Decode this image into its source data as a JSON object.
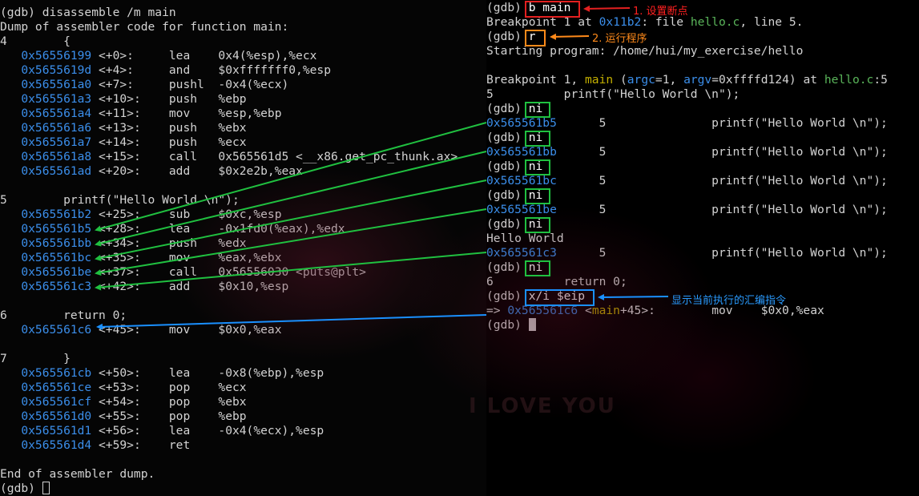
{
  "colors": {
    "address": "#3b8eea",
    "function_name": "#c4b000",
    "file_name": "#5ab55a",
    "annotation_red": "#e32020",
    "annotation_orange": "#ff8a1a",
    "annotation_green": "#20c040",
    "annotation_blue": "#1a90ff"
  },
  "left_terminal": {
    "command_line": "(gdb) disassemble /m main",
    "header": "Dump of assembler code for function main:",
    "src_4_num": "4",
    "src_4_code": "        {",
    "src_5_num": "5",
    "src_5_code": "        printf(\"Hello World \\n\");",
    "src_6_num": "6",
    "src_6_code": "        return 0;",
    "src_7_num": "7",
    "src_7_code": "        }",
    "block1": [
      {
        "addr": "0x56556199",
        "offset": " <+0>:     ",
        "mnemonic": "lea    ",
        "operands": "0x4(%esp),%ecx"
      },
      {
        "addr": "0x5655619d",
        "offset": " <+4>:     ",
        "mnemonic": "and    ",
        "operands": "$0xfffffff0,%esp"
      },
      {
        "addr": "0x565561a0",
        "offset": " <+7>:     ",
        "mnemonic": "pushl  ",
        "operands": "-0x4(%ecx)"
      },
      {
        "addr": "0x565561a3",
        "offset": " <+10>:    ",
        "mnemonic": "push   ",
        "operands": "%ebp"
      },
      {
        "addr": "0x565561a4",
        "offset": " <+11>:    ",
        "mnemonic": "mov    ",
        "operands": "%esp,%ebp"
      },
      {
        "addr": "0x565561a6",
        "offset": " <+13>:    ",
        "mnemonic": "push   ",
        "operands": "%ebx"
      },
      {
        "addr": "0x565561a7",
        "offset": " <+14>:    ",
        "mnemonic": "push   ",
        "operands": "%ecx"
      },
      {
        "addr": "0x565561a8",
        "offset": " <+15>:    ",
        "mnemonic": "call   ",
        "operands": "0x565561d5 <__x86.get_pc_thunk.ax>"
      },
      {
        "addr": "0x565561ad",
        "offset": " <+20>:    ",
        "mnemonic": "add    ",
        "operands": "$0x2e2b,%eax"
      }
    ],
    "block2": [
      {
        "addr": "0x565561b2",
        "offset": " <+25>:    ",
        "mnemonic": "sub    ",
        "operands": "$0xc,%esp"
      },
      {
        "addr": "0x565561b5",
        "offset": " <+28>:    ",
        "mnemonic": "lea    ",
        "operands": "-0x1fd0(%eax),%edx"
      },
      {
        "addr": "0x565561bb",
        "offset": " <+34>:    ",
        "mnemonic": "push   ",
        "operands": "%edx"
      },
      {
        "addr": "0x565561bc",
        "offset": " <+35>:    ",
        "mnemonic": "mov    ",
        "operands": "%eax,%ebx"
      },
      {
        "addr": "0x565561be",
        "offset": " <+37>:    ",
        "mnemonic": "call   ",
        "operands": "0x56556030 <puts@plt>"
      },
      {
        "addr": "0x565561c3",
        "offset": " <+42>:    ",
        "mnemonic": "add    ",
        "operands": "$0x10,%esp"
      }
    ],
    "block3": [
      {
        "addr": "0x565561c6",
        "offset": " <+45>:    ",
        "mnemonic": "mov    ",
        "operands": "$0x0,%eax"
      }
    ],
    "block4": [
      {
        "addr": "0x565561cb",
        "offset": " <+50>:    ",
        "mnemonic": "lea    ",
        "operands": "-0x8(%ebp),%esp"
      },
      {
        "addr": "0x565561ce",
        "offset": " <+53>:    ",
        "mnemonic": "pop    ",
        "operands": "%ecx"
      },
      {
        "addr": "0x565561cf",
        "offset": " <+54>:    ",
        "mnemonic": "pop    ",
        "operands": "%ebx"
      },
      {
        "addr": "0x565561d0",
        "offset": " <+55>:    ",
        "mnemonic": "pop    ",
        "operands": "%ebp"
      },
      {
        "addr": "0x565561d1",
        "offset": " <+56>:    ",
        "mnemonic": "lea    ",
        "operands": "-0x4(%ecx),%esp"
      },
      {
        "addr": "0x565561d4",
        "offset": " <+59>:    ",
        "mnemonic": "ret    ",
        "operands": ""
      }
    ],
    "footer": "End of assembler dump.",
    "prompt": "(gdb) "
  },
  "right_terminal": {
    "prompt": "(gdb) ",
    "cmd_break": "b main",
    "bp_pre": "Breakpoint 1 at ",
    "bp_addr": "0x11b2",
    "bp_mid": ": file ",
    "bp_file": "hello.c",
    "bp_post": ", line 5.",
    "cmd_run": "r",
    "starting": "Starting program: /home/hui/my_exercise/hello",
    "hit_pre": "Breakpoint 1, ",
    "hit_fn": "main",
    "hit_args_pre": " (",
    "hit_arg1": "argc",
    "hit_args_mid": "=1, ",
    "hit_arg2": "argv",
    "hit_args_post": "=0xffffd124) at ",
    "hit_file": "hello.c",
    "hit_line": ":5",
    "src5_num": "5",
    "src5_code": "          printf(\"Hello World \\n\");",
    "cmd_ni": "ni",
    "step_lines": [
      {
        "addr": "0x565561b5",
        "rest": "      5               printf(\"Hello World \\n\");"
      },
      {
        "addr": "0x565561bb",
        "rest": "      5               printf(\"Hello World \\n\");"
      },
      {
        "addr": "0x565561bc",
        "rest": "      5               printf(\"Hello World \\n\");"
      },
      {
        "addr": "0x565561be",
        "rest": "      5               printf(\"Hello World \\n\");"
      },
      {
        "addr": "0x565561c3",
        "rest": "      5               printf(\"Hello World \\n\");"
      }
    ],
    "program_output": "Hello World",
    "src6_num": "6",
    "src6_code": "          return 0;",
    "cmd_xi": "x/i $eip",
    "cur_prefix": "=> ",
    "cur_addr": "0x565561c6",
    "cur_sym_pre": " <",
    "cur_sym_fn": "main",
    "cur_sym_post": "+45>:",
    "cur_instr": "        mov    $0x0,%eax"
  },
  "annotations": {
    "set_breakpoint": "1. 设置断点",
    "run_program": "2. 运行程序",
    "show_current_instr": "显示当前执行的汇编指令"
  },
  "wallpaper_text": "I LOVE YOU"
}
